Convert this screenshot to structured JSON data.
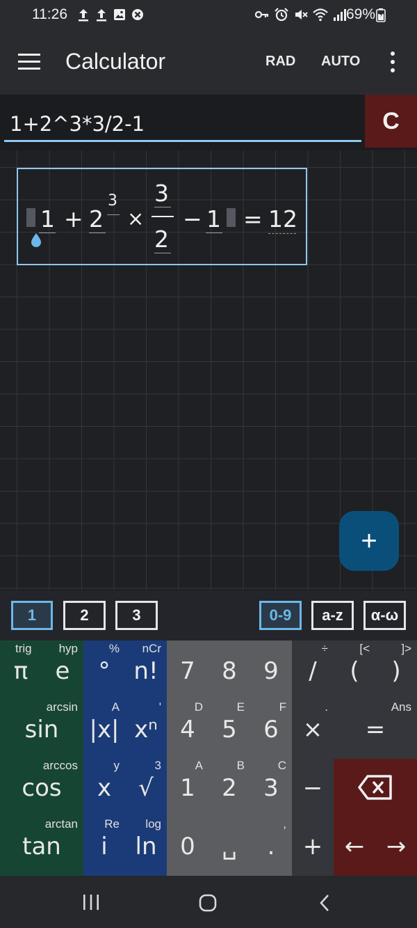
{
  "status_bar": {
    "time": "11:26",
    "battery": "69%",
    "left_icons": [
      "upload-icon",
      "upload-icon",
      "image-icon",
      "blocked-icon"
    ],
    "right_icons": [
      "key-icon",
      "alarm-icon",
      "mute-icon",
      "wifi-icon",
      "signal-icon",
      "battery-icon"
    ]
  },
  "app_bar": {
    "title": "Calculator",
    "angle_mode": "RAD",
    "format_mode": "AUTO"
  },
  "input": {
    "expression": "1+2^3*3/2-1",
    "clear_label": "C"
  },
  "result": {
    "terms": [
      "1",
      "+",
      "2",
      "3",
      "×",
      "3",
      "2",
      "−",
      "1",
      "=",
      "12"
    ]
  },
  "fab": {
    "label": "+"
  },
  "keypad_tabs": {
    "pages": [
      "1",
      "2",
      "3"
    ],
    "modes": [
      "0-9",
      "a-z",
      "α-ω"
    ],
    "active_page": "1",
    "active_mode": "0-9"
  },
  "keypad": {
    "rows": [
      [
        {
          "main": "π",
          "alt": "trig"
        },
        {
          "main": "e",
          "alt": "hyp"
        },
        {
          "main": "°",
          "alt": "%"
        },
        {
          "main": "n!",
          "alt": "nCr"
        },
        {
          "main": "7",
          "alt": ""
        },
        {
          "main": "8",
          "alt": ""
        },
        {
          "main": "9",
          "alt": ""
        },
        {
          "main": "/",
          "alt": "÷"
        },
        {
          "main": "(",
          "alt": "[<"
        },
        {
          "main": ")",
          "alt": "]>"
        }
      ],
      [
        {
          "main": "sin",
          "alt": "arcsin"
        },
        {
          "main": "|x|",
          "alt": "A"
        },
        {
          "main": "xⁿ",
          "alt": "'"
        },
        {
          "main": "4",
          "alt": "D"
        },
        {
          "main": "5",
          "alt": "E"
        },
        {
          "main": "6",
          "alt": "F"
        },
        {
          "main": "×",
          "alt": "."
        },
        {
          "main": "=",
          "alt": "Ans"
        }
      ],
      [
        {
          "main": "cos",
          "alt": "arccos"
        },
        {
          "main": "x",
          "alt": "y"
        },
        {
          "main": "√",
          "alt": "3"
        },
        {
          "main": "1",
          "alt": "A"
        },
        {
          "main": "2",
          "alt": "B"
        },
        {
          "main": "3",
          "alt": "C"
        },
        {
          "main": "−",
          "alt": ""
        },
        {
          "main": "⌫",
          "alt": ""
        }
      ],
      [
        {
          "main": "tan",
          "alt": "arctan"
        },
        {
          "main": "i",
          "alt": "Re"
        },
        {
          "main": "ln",
          "alt": "log"
        },
        {
          "main": "0",
          "alt": ""
        },
        {
          "main": "␣",
          "alt": ""
        },
        {
          "main": ".",
          "alt": ","
        },
        {
          "main": "+",
          "alt": ""
        },
        {
          "main": "←",
          "alt": ""
        },
        {
          "main": "→",
          "alt": ""
        }
      ]
    ]
  },
  "colors": {
    "trig_column": "#174534",
    "function_column": "#1b3b78",
    "digit_column": "#5c5d60",
    "operator_column": "#34363b",
    "delete_key": "#5a1a1a",
    "accent": "#8cc8f0"
  }
}
